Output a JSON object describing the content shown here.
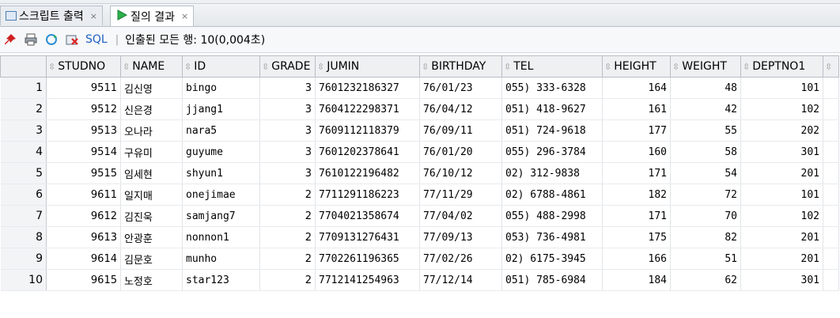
{
  "tabs": [
    {
      "label": "스크립트 출력",
      "close": "×",
      "active": false
    },
    {
      "label": "질의 결과",
      "close": "×",
      "active": true
    }
  ],
  "toolbar": {
    "sql_label": "SQL",
    "separator": "|",
    "status": "인출된 모든 행: 10(0,004초)"
  },
  "table": {
    "sort_glyph": "⇳",
    "columns": [
      "STUDNO",
      "NAME",
      "ID",
      "GRADE",
      "JUMIN",
      "BIRTHDAY",
      "TEL",
      "HEIGHT",
      "WEIGHT",
      "DEPTNO1"
    ],
    "rows": [
      {
        "rn": "1",
        "studno": "9511",
        "name": "김신영",
        "id": "bingo",
        "grade": "3",
        "jumin": "7601232186327",
        "birthday": "76/01/23",
        "tel": "055) 333-6328",
        "height": "164",
        "weight": "48",
        "deptno1": "101"
      },
      {
        "rn": "2",
        "studno": "9512",
        "name": "신은경",
        "id": "jjang1",
        "grade": "3",
        "jumin": "7604122298371",
        "birthday": "76/04/12",
        "tel": "051) 418-9627",
        "height": "161",
        "weight": "42",
        "deptno1": "102"
      },
      {
        "rn": "3",
        "studno": "9513",
        "name": "오나라",
        "id": "nara5",
        "grade": "3",
        "jumin": "7609112118379",
        "birthday": "76/09/11",
        "tel": "051) 724-9618",
        "height": "177",
        "weight": "55",
        "deptno1": "202"
      },
      {
        "rn": "4",
        "studno": "9514",
        "name": "구유미",
        "id": "guyume",
        "grade": "3",
        "jumin": "7601202378641",
        "birthday": "76/01/20",
        "tel": "055) 296-3784",
        "height": "160",
        "weight": "58",
        "deptno1": "301"
      },
      {
        "rn": "5",
        "studno": "9515",
        "name": "임세현",
        "id": "shyun1",
        "grade": "3",
        "jumin": "7610122196482",
        "birthday": "76/10/12",
        "tel": "02) 312-9838",
        "height": "171",
        "weight": "54",
        "deptno1": "201"
      },
      {
        "rn": "6",
        "studno": "9611",
        "name": "일지매",
        "id": "onejimae",
        "grade": "2",
        "jumin": "7711291186223",
        "birthday": "77/11/29",
        "tel": "02) 6788-4861",
        "height": "182",
        "weight": "72",
        "deptno1": "101"
      },
      {
        "rn": "7",
        "studno": "9612",
        "name": "김진욱",
        "id": "samjang7",
        "grade": "2",
        "jumin": "7704021358674",
        "birthday": "77/04/02",
        "tel": "055) 488-2998",
        "height": "171",
        "weight": "70",
        "deptno1": "102"
      },
      {
        "rn": "8",
        "studno": "9613",
        "name": "안광훈",
        "id": "nonnon1",
        "grade": "2",
        "jumin": "7709131276431",
        "birthday": "77/09/13",
        "tel": "053) 736-4981",
        "height": "175",
        "weight": "82",
        "deptno1": "201"
      },
      {
        "rn": "9",
        "studno": "9614",
        "name": "김문호",
        "id": "munho",
        "grade": "2",
        "jumin": "7702261196365",
        "birthday": "77/02/26",
        "tel": "02) 6175-3945",
        "height": "166",
        "weight": "51",
        "deptno1": "201"
      },
      {
        "rn": "10",
        "studno": "9615",
        "name": "노정호",
        "id": "star123",
        "grade": "2",
        "jumin": "7712141254963",
        "birthday": "77/12/14",
        "tel": "051) 785-6984",
        "height": "184",
        "weight": "62",
        "deptno1": "301"
      }
    ]
  },
  "colors": {
    "sql_link": "#1f5fbf",
    "run_icon": "#2bb24c",
    "pin_icon": "#d02020"
  }
}
